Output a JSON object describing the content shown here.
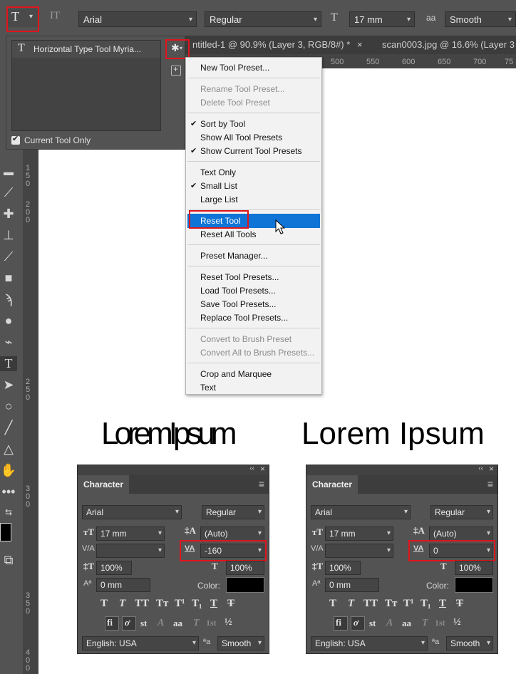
{
  "options_bar": {
    "tool_icon": "T",
    "orient_icon": "IT",
    "font_family": "Arial",
    "font_style": "Regular",
    "size_icon": "T",
    "font_size": "17 mm",
    "aa_icon": "aa",
    "antialias": "Smooth"
  },
  "tabs": [
    "ntitled-1 @ 90.9% (Layer 3, RGB/8#) *",
    "scan0003.jpg @ 16.6% (Layer 3"
  ],
  "tab_close": "×",
  "ruler_top": [
    "500",
    "550",
    "600",
    "650",
    "700",
    "75"
  ],
  "ruler_left": [
    "1",
    "5",
    "0",
    "2",
    "0",
    "0",
    "2",
    "5",
    "0",
    "3",
    "0",
    "0",
    "3",
    "5",
    "0",
    "4",
    "0",
    "0"
  ],
  "preset_panel": {
    "item_icon": "T",
    "item_label": "Horizontal Type Tool Myria...",
    "current_tool_only": "Current Tool Only",
    "gear_icon": "✱",
    "new_preset_icon": "+"
  },
  "menu": {
    "new_tool_preset": "New Tool Preset...",
    "rename_tool_preset": "Rename Tool Preset...",
    "delete_tool_preset": "Delete Tool Preset",
    "sort_by_tool": "Sort by Tool",
    "show_all_tool_presets": "Show All Tool Presets",
    "show_current_tool_presets": "Show Current Tool Presets",
    "text_only": "Text Only",
    "small_list": "Small List",
    "large_list": "Large List",
    "reset_tool": "Reset Tool",
    "reset_all_tools": "Reset All Tools",
    "preset_manager": "Preset Manager...",
    "reset_tool_presets": "Reset Tool Presets...",
    "load_tool_presets": "Load Tool Presets...",
    "save_tool_presets": "Save Tool Presets...",
    "replace_tool_presets": "Replace Tool Presets...",
    "convert_to_brush_preset": "Convert to Brush Preset",
    "convert_all_to_brush_presets": "Convert All to Brush Presets...",
    "crop_and_marquee": "Crop and Marquee",
    "text": "Text",
    "check": "✔"
  },
  "samples": {
    "tight": "LoremIpsum",
    "normal": "Lorem Ipsum"
  },
  "char_panels": [
    {
      "title": "Character",
      "font_family": "Arial",
      "font_style": "Regular",
      "font_size": "17 mm",
      "leading": "(Auto)",
      "kerning": "",
      "tracking": "-160",
      "vertical_scale": "100%",
      "horizontal_scale": "100%",
      "baseline_shift": "0 mm",
      "color_label": "Color:",
      "language": "English: USA",
      "antialias": "Smooth",
      "tracking_icon": "VA",
      "kerning_icon": "V/A",
      "collapse_icon": "‹‹",
      "close_icon": "×",
      "menu_icon": "≡",
      "style_glyphs": [
        "T",
        "T",
        "TT",
        "Tт",
        "T¹",
        "T₁",
        "T",
        "T"
      ],
      "opentype_glyphs": [
        "fi",
        "ơ",
        "st",
        "A",
        "aa",
        "T",
        "1st",
        "½"
      ]
    },
    {
      "title": "Character",
      "font_family": "Arial",
      "font_style": "Regular",
      "font_size": "17 mm",
      "leading": "(Auto)",
      "kerning": "",
      "tracking": "0",
      "vertical_scale": "100%",
      "horizontal_scale": "100%",
      "baseline_shift": "0 mm",
      "color_label": "Color:",
      "language": "English: USA",
      "antialias": "Smooth",
      "tracking_icon": "VA",
      "kerning_icon": "V/A",
      "collapse_icon": "‹‹",
      "close_icon": "×",
      "menu_icon": "≡",
      "style_glyphs": [
        "T",
        "T",
        "TT",
        "Tт",
        "T¹",
        "T₁",
        "T",
        "T"
      ],
      "opentype_glyphs": [
        "fi",
        "ơ",
        "st",
        "A",
        "aa",
        "T",
        "1st",
        "½"
      ]
    }
  ],
  "colors": {
    "highlight": "#0f74d6",
    "annotation_red": "#e0141c",
    "panel_bg": "#535353"
  }
}
